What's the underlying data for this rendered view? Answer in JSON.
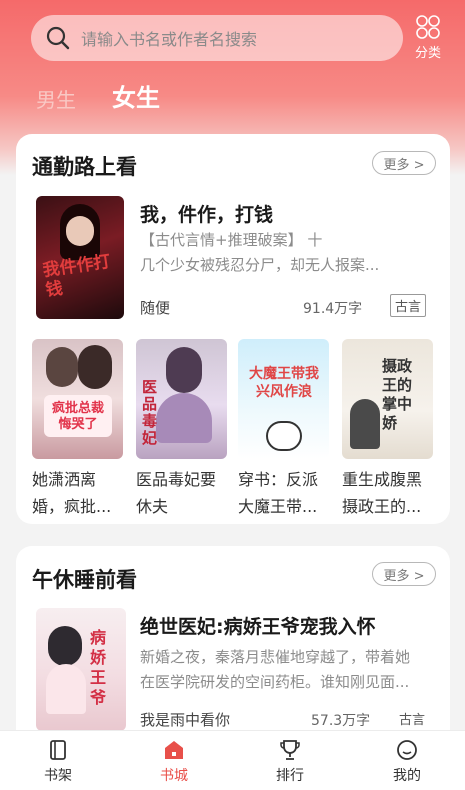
{
  "search": {
    "placeholder": "请输入书名或作者名搜索",
    "category_label": "分类"
  },
  "gender_tabs": [
    {
      "label": "男生",
      "active": false
    },
    {
      "label": "女生",
      "active": true
    }
  ],
  "sections": [
    {
      "title": "通勤路上看",
      "more_label": "更多 >",
      "featured": {
        "title": "我，件作，打钱",
        "desc_line1": "【古代言情+推理破案】  十",
        "desc_line2": "几个少女被残忍分尸，却无人报案...",
        "author": "随便",
        "words": "91.4万字",
        "tag": "古言",
        "cover_text": "我件作打钱"
      },
      "grid": [
        {
          "title": "她潇洒离婚，疯批...",
          "cover_text": "疯批总裁悔哭了"
        },
        {
          "title": "医品毒妃要休夫",
          "cover_text": "医品毒妃"
        },
        {
          "title": "穿书：反派大魔王带...",
          "cover_text": "大魔王带我兴风作浪"
        },
        {
          "title": "重生成腹黑摄政王的...",
          "cover_text": "摄政王的掌中娇"
        }
      ]
    },
    {
      "title": "午休睡前看",
      "more_label": "更多 >",
      "featured": {
        "title": "绝世医妃:病娇王爷宠我入怀",
        "desc_line1": "新婚之夜，秦落月悲催地穿越了，带着她",
        "desc_line2": "在医学院研发的空间药柜。谁知刚见面...",
        "author": "我是雨中看你",
        "words": "57.3万字",
        "tag": "古言",
        "cover_text": "病娇王爷"
      }
    }
  ],
  "bottom_nav": [
    {
      "label": "书架",
      "icon": "bookshelf-icon",
      "active": false
    },
    {
      "label": "书城",
      "icon": "bookstore-home-icon",
      "active": true
    },
    {
      "label": "排行",
      "icon": "trophy-icon",
      "active": false
    },
    {
      "label": "我的",
      "icon": "profile-icon",
      "active": false
    }
  ],
  "colors": {
    "accent": "#e8504a",
    "header_top": "#f56a6a"
  }
}
